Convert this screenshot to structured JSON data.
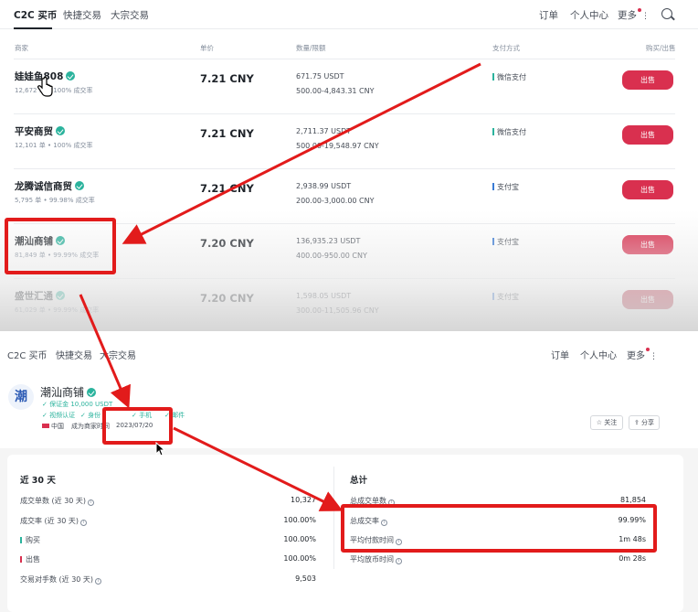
{
  "top": {
    "nav": {
      "tabs": [
        "C2C 买币",
        "快捷交易",
        "大宗交易"
      ],
      "orders": "订单",
      "personal_center": "个人中心",
      "more": "更多"
    },
    "headers": {
      "merchant": "商家",
      "price": "单价",
      "amount": "数量/限额",
      "payment": "支付方式",
      "action": "购买/出售"
    },
    "rows": [
      {
        "name": "娃娃鱼808",
        "stats": "12,672 单 • 100% 成交率",
        "price": "7.21 CNY",
        "available": "671.75 USDT",
        "limit": "500.00-4,843.31 CNY",
        "payment": "微信支付",
        "button": "出售"
      },
      {
        "name": "平安商贸",
        "stats": "12,101 单 • 100% 成交率",
        "price": "7.21 CNY",
        "available": "2,711.37 USDT",
        "limit": "500.00-19,548.97 CNY",
        "payment": "微信支付",
        "button": "出售"
      },
      {
        "name": "龙腾诚信商贸",
        "stats": "5,795 单 • 99.98% 成交率",
        "price": "7.21 CNY",
        "available": "2,938.99 USDT",
        "limit": "200.00-3,000.00 CNY",
        "payment": "支付宝",
        "button": "出售"
      },
      {
        "name": "潮汕商铺",
        "stats": "81,849 单 • 99.99% 成交率",
        "price": "7.20 CNY",
        "available": "136,935.23 USDT",
        "limit": "400.00-950.00 CNY",
        "payment": "支付宝",
        "button": "出售"
      },
      {
        "name": "盛世汇通",
        "stats": "61,029 单 • 99.99% 成交率",
        "price": "7.20 CNY",
        "available": "1,598.05 USDT",
        "limit": "300.00-11,505.96 CNY",
        "payment": "支付宝",
        "button": "出售"
      }
    ]
  },
  "bottom": {
    "nav": {
      "tabs": [
        "C2C 买币",
        "快捷交易",
        "大宗交易"
      ],
      "orders": "订单",
      "personal_center": "个人中心",
      "more": "更多"
    },
    "merchant": {
      "avatar": "潮",
      "name": "潮汕商铺",
      "deposit": "✓ 保证金 10,000 USDT",
      "verify_video": "✓ 视频认证",
      "verify_id": "✓ 身份",
      "verify_phone": "✓ 手机",
      "verify_email": "✓ 邮件",
      "country": "中国",
      "since_label": "成为商家时间",
      "since_date": "2023/07/20",
      "follow_button": "☆ 关注",
      "share_button": "分享"
    },
    "last30": {
      "title": "近 30 天",
      "rows": [
        {
          "label": "成交单数 (近 30 天)",
          "value": "10,327"
        },
        {
          "label": "成交率 (近 30 天)",
          "value": "100.00%"
        },
        {
          "label": "购买",
          "value": "100.00%"
        },
        {
          "label": "出售",
          "value": "100.00%"
        },
        {
          "label": "交易对手数 (近 30 天)",
          "value": "9,503"
        }
      ]
    },
    "total": {
      "title": "总计",
      "rows": [
        {
          "label": "总成交单数",
          "value": "81,854"
        },
        {
          "label": "总成交率",
          "value": "99.99%"
        },
        {
          "label": "平均付款时间",
          "value": "1m 48s"
        },
        {
          "label": "平均放币时间",
          "value": "0m 28s"
        }
      ]
    }
  },
  "colors": {
    "sell_button": "#d9304f",
    "verified_badge": "#2bb39d",
    "annotation_red": "#e21b1b"
  }
}
